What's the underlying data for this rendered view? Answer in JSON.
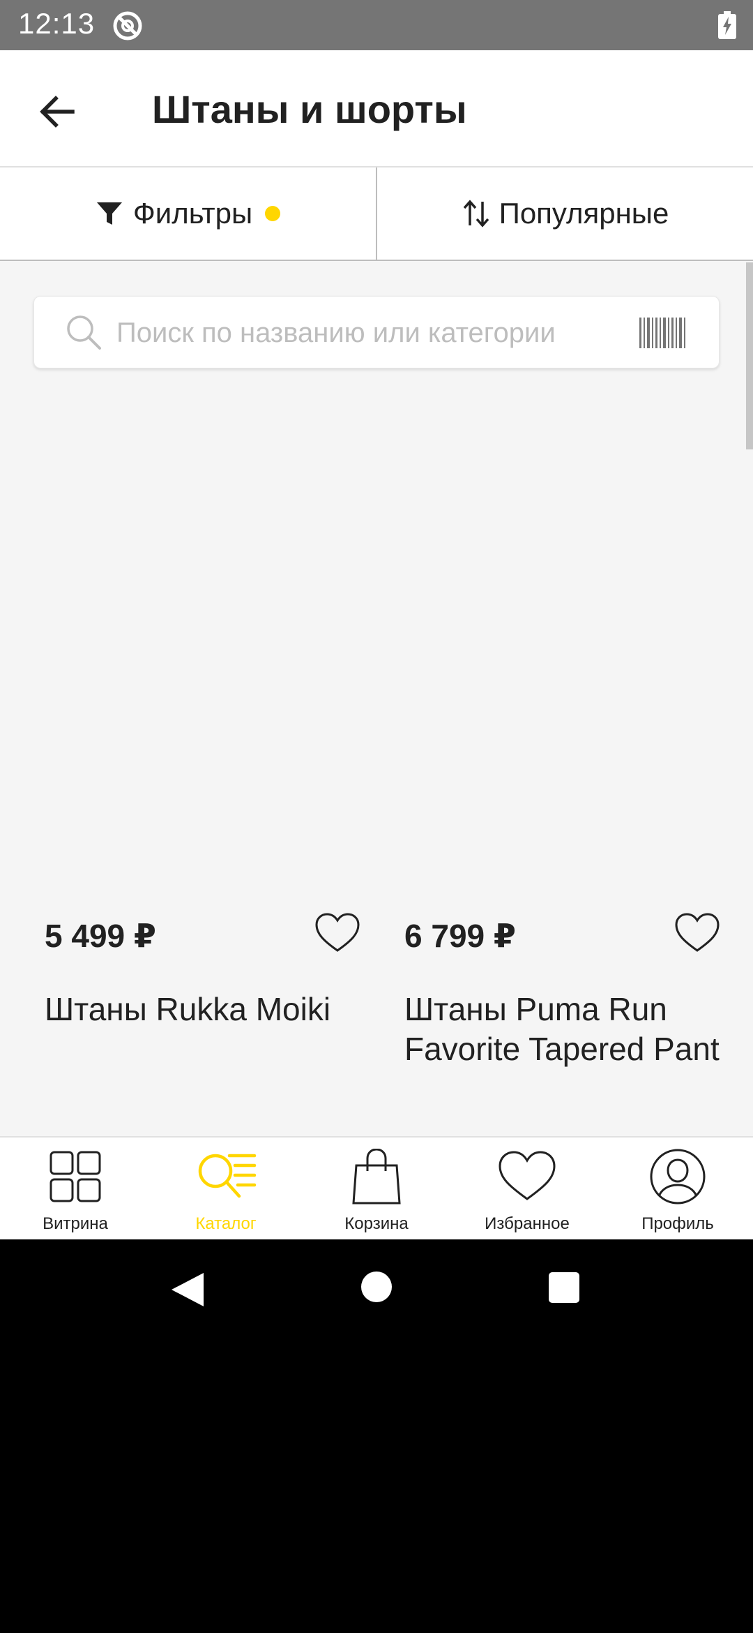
{
  "status_bar": {
    "time": "12:13"
  },
  "header": {
    "title": "Штаны и шорты"
  },
  "toolbar": {
    "filters_label": "Фильтры",
    "sort_label": "Популярные",
    "accent_color": "#ffd600"
  },
  "search": {
    "placeholder": "Поиск по названию или категории"
  },
  "products": [
    {
      "price": "5 499 ₽",
      "name": "Штаны Rukka Moiki"
    },
    {
      "price": "6 799 ₽",
      "name": "Штаны Puma Run Favorite Tapered Pant"
    }
  ],
  "bottom_nav": {
    "items": [
      {
        "label": "Витрина",
        "icon": "grid-icon"
      },
      {
        "label": "Каталог",
        "icon": "catalog-search-icon",
        "active": true
      },
      {
        "label": "Корзина",
        "icon": "shopping-bag-icon"
      },
      {
        "label": "Избранное",
        "icon": "heart-icon"
      },
      {
        "label": "Профиль",
        "icon": "profile-icon"
      }
    ]
  }
}
